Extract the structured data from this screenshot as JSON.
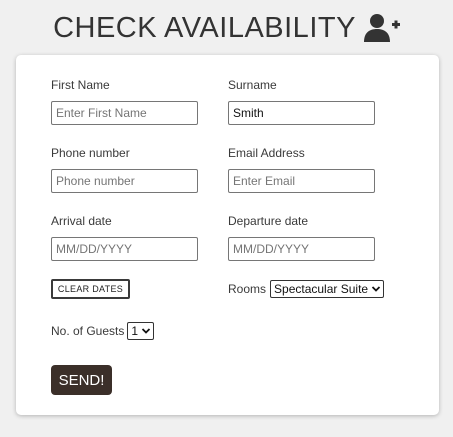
{
  "header": {
    "title": "CHECK AVAILABILITY",
    "icon": "user-plus-icon"
  },
  "form": {
    "first_name": {
      "label": "First Name",
      "placeholder": "Enter First Name",
      "value": ""
    },
    "surname": {
      "label": "Surname",
      "placeholder": "",
      "value": "Smith"
    },
    "phone": {
      "label": "Phone number",
      "placeholder": "Phone number",
      "value": ""
    },
    "email": {
      "label": "Email Address",
      "placeholder": "Enter Email",
      "value": ""
    },
    "arrival": {
      "label": "Arrival date",
      "placeholder": "MM/DD/YYYY",
      "value": ""
    },
    "departure": {
      "label": "Departure date",
      "placeholder": "MM/DD/YYYY",
      "value": ""
    },
    "clear_dates_label": "CLEAR DATES",
    "rooms": {
      "label": "Rooms",
      "selected": "Spectacular Suite"
    },
    "guests": {
      "label": "No. of Guests",
      "selected": "1"
    },
    "send_label": "SEND!"
  },
  "colors": {
    "background": "#f0f0f0",
    "card": "#ffffff",
    "send_button": "#3b2f29",
    "text": "#3a3a3a"
  }
}
